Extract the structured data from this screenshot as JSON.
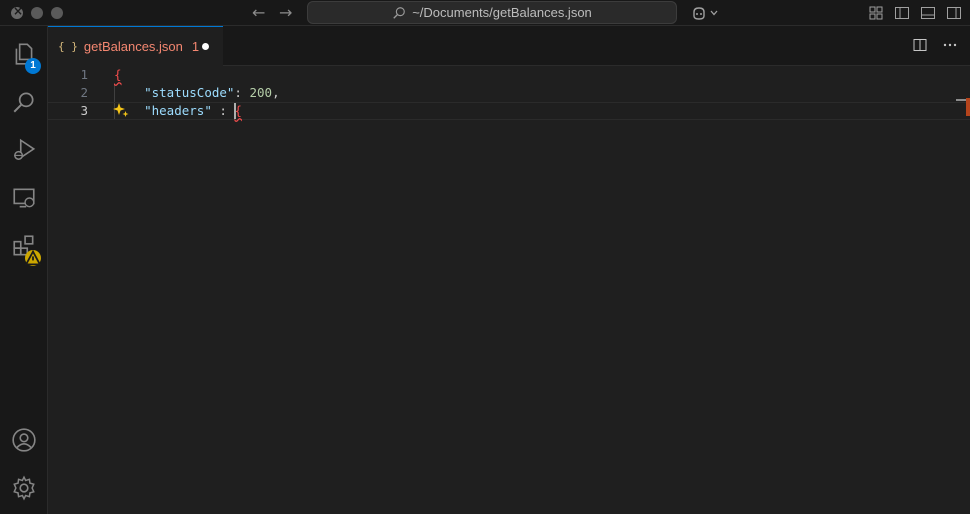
{
  "titlebar": {
    "search_text": "~/Documents/getBalances.json"
  },
  "activity": {
    "explorer_badge": "1"
  },
  "tab": {
    "icon_text": "{ }",
    "label": "getBalances.json",
    "problem_count": "1"
  },
  "editor": {
    "lines": [
      {
        "number": "1",
        "brace": "{"
      },
      {
        "number": "2",
        "key": "\"statusCode\"",
        "sep": ": ",
        "value": "200",
        "trail": ","
      },
      {
        "number": "3",
        "key": "\"headers\"",
        "sep": " : ",
        "brace": "{"
      }
    ]
  },
  "colors": {
    "accent": "#0078d4",
    "error": "#f14c4c",
    "warning": "#cca700",
    "modified_tab": "#f48771"
  }
}
